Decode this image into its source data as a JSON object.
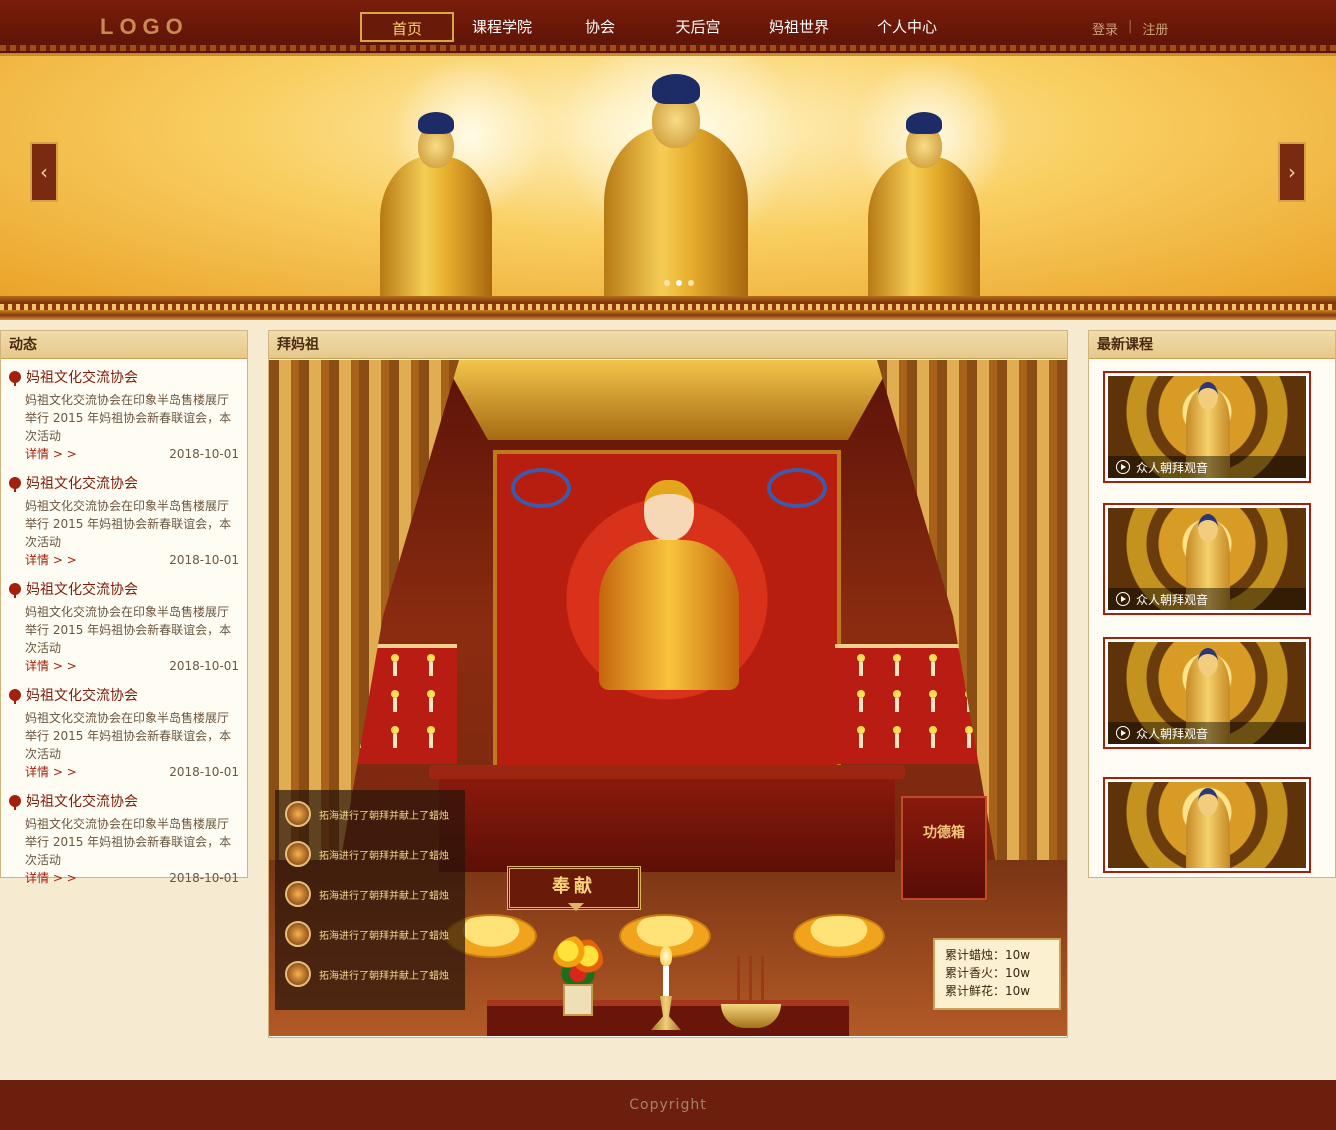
{
  "header": {
    "logo": "LOGO",
    "nav": [
      {
        "label": "首页",
        "active": true
      },
      {
        "label": "课程学院",
        "active": false
      },
      {
        "label": "协会",
        "active": false
      },
      {
        "label": "天后宫",
        "active": false
      },
      {
        "label": "妈祖世界",
        "active": false
      },
      {
        "label": "个人中心",
        "active": false
      }
    ],
    "login": "登录",
    "separator": "|",
    "register": "注册"
  },
  "banner": {
    "prev_icon": "chevron-left-icon",
    "next_icon": "chevron-right-icon",
    "slide_count": 3,
    "active_slide": 2
  },
  "news_panel": {
    "title": "动态",
    "items": [
      {
        "title": "妈祖文化交流协会",
        "desc": "妈祖文化交流协会在印象半岛售楼展厅举行 2015 年妈祖协会新春联谊会，本次活动",
        "more": "详情 > >",
        "date": "2018-10-01"
      },
      {
        "title": "妈祖文化交流协会",
        "desc": "妈祖文化交流协会在印象半岛售楼展厅举行 2015 年妈祖协会新春联谊会，本次活动",
        "more": "详情 > >",
        "date": "2018-10-01"
      },
      {
        "title": "妈祖文化交流协会",
        "desc": "妈祖文化交流协会在印象半岛售楼展厅举行 2015 年妈祖协会新春联谊会，本次活动",
        "more": "详情 > >",
        "date": "2018-10-01"
      },
      {
        "title": "妈祖文化交流协会",
        "desc": "妈祖文化交流协会在印象半岛售楼展厅举行 2015 年妈祖协会新春联谊会，本次活动",
        "more": "详情 > >",
        "date": "2018-10-01"
      },
      {
        "title": "妈祖文化交流协会",
        "desc": "妈祖文化交流协会在印象半岛售楼展厅举行 2015 年妈祖协会新春联谊会，本次活动",
        "more": "详情 > >",
        "date": "2018-10-01"
      }
    ]
  },
  "worship_panel": {
    "title": "拜妈祖",
    "donation_box": "功德箱",
    "offer_button": "奉献",
    "feed": [
      "拓海进行了朝拜并献上了蜡烛",
      "拓海进行了朝拜并献上了蜡烛",
      "拓海进行了朝拜并献上了蜡烛",
      "拓海进行了朝拜并献上了蜡烛",
      "拓海进行了朝拜并献上了蜡烛"
    ],
    "stats": [
      {
        "label": "累计蜡烛：",
        "value": "10w"
      },
      {
        "label": "累计香火：",
        "value": "10w"
      },
      {
        "label": "累计鲜花：",
        "value": "10w"
      }
    ]
  },
  "course_panel": {
    "title": "最新课程",
    "items": [
      {
        "caption": "众人朝拜观音",
        "icon": "play-icon"
      },
      {
        "caption": "众人朝拜观音",
        "icon": "play-icon"
      },
      {
        "caption": "众人朝拜观音",
        "icon": "play-icon"
      },
      {
        "caption": "",
        "icon": ""
      }
    ]
  },
  "footer": {
    "copyright": "Copyright"
  },
  "colors": {
    "header_bg": "#6b1a08",
    "accent_gold": "#d8a74a",
    "title_red": "#7c1c0c",
    "footer_bg": "#6b1f0c"
  }
}
